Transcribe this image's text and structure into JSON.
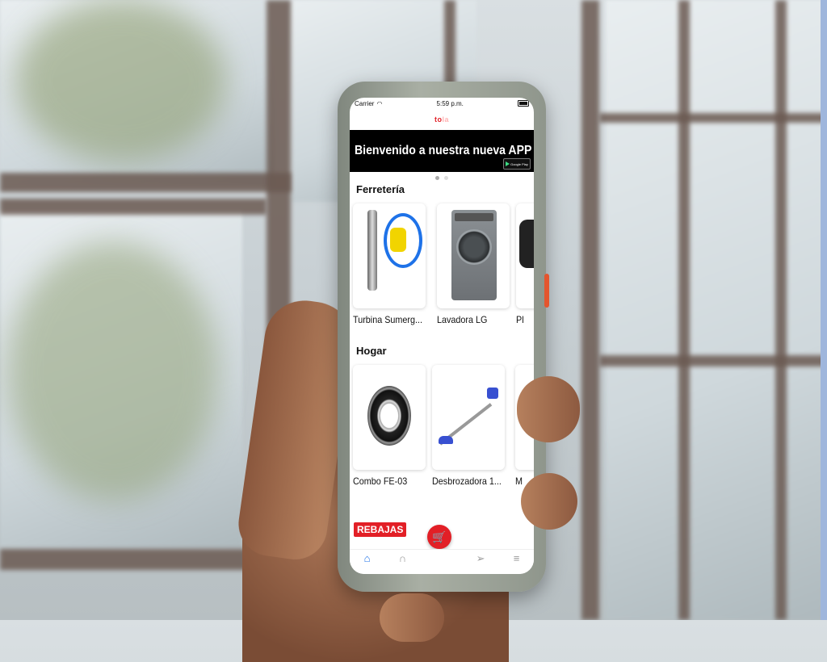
{
  "status_bar": {
    "carrier": "Carrier",
    "time": "5:59 p.m."
  },
  "app": {
    "logo_text": "to",
    "logo_text_faded": "la",
    "brand_color": "#e21f26"
  },
  "banner": {
    "text": "Bienvenido a nuestra nueva APP",
    "badge": "Google Play"
  },
  "sections": [
    {
      "title": "Ferretería",
      "products": [
        {
          "label": "Turbina Sumerg...",
          "icon": "pump-image"
        },
        {
          "label": "Lavadora LG",
          "icon": "washer-image"
        },
        {
          "label": "Pl",
          "icon": "partial-image"
        }
      ]
    },
    {
      "title": "Hogar",
      "products": [
        {
          "label": "Combo FE-03",
          "icon": "bearing-image"
        },
        {
          "label": "Desbrozadora 1...",
          "icon": "trimmer-image"
        },
        {
          "label": "M",
          "icon": "partial-image"
        }
      ]
    }
  ],
  "promo": {
    "label": "REBAJAS"
  },
  "tabs": [
    {
      "icon": "home-icon",
      "glyph": "⌂",
      "active": true
    },
    {
      "icon": "bell-icon",
      "glyph": "∩",
      "active": false
    },
    {
      "icon": "cart-icon",
      "glyph": "🛒",
      "active": false
    },
    {
      "icon": "send-icon",
      "glyph": "➢",
      "active": false
    },
    {
      "icon": "menu-icon",
      "glyph": "≡",
      "active": false
    }
  ],
  "cart_glyph": "🛒"
}
